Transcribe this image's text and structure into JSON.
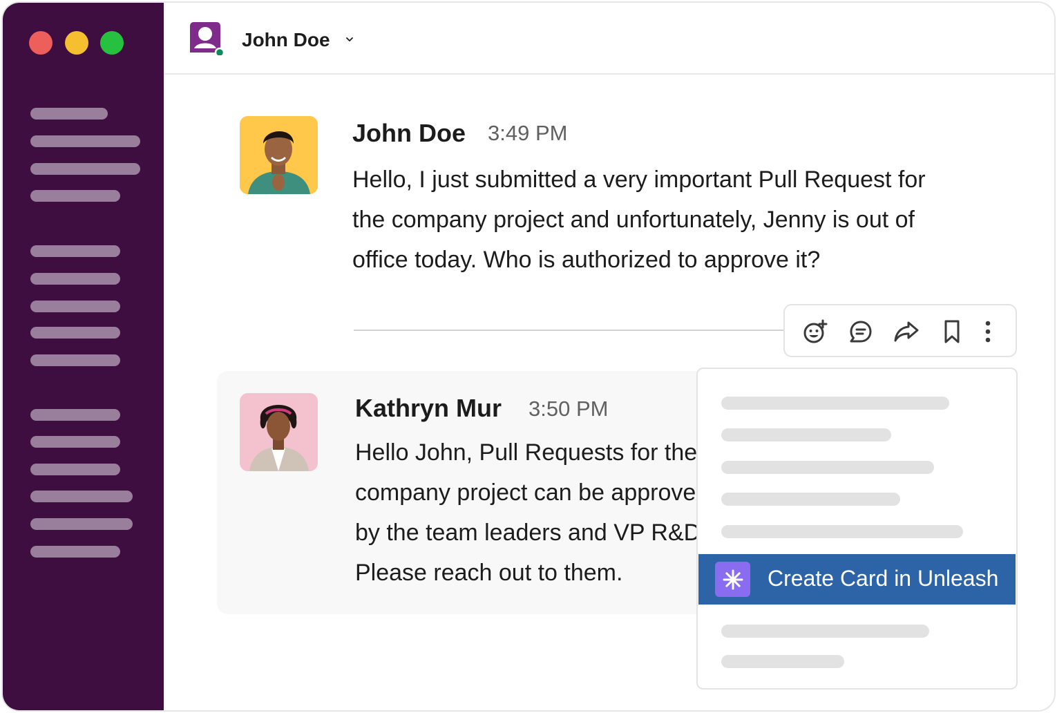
{
  "header": {
    "workspace_name": "John Doe"
  },
  "messages": [
    {
      "author": "John Doe",
      "time": "3:49 PM",
      "lines": [
        "Hello, I just submitted a very important Pull Request for",
        "the company project and unfortunately, Jenny is out of",
        "office today. Who is authorized to approve it?"
      ]
    },
    {
      "author": "Kathryn Mur",
      "time": "3:50 PM",
      "lines": [
        "Hello John, Pull Requests for the",
        "company project can be approved",
        "by the team leaders and VP R&D.",
        "Please reach out to them."
      ]
    }
  ],
  "message_actions": {
    "icons": [
      "add-reaction-icon",
      "reply-in-thread-icon",
      "share-icon",
      "bookmark-icon",
      "more-actions-icon"
    ]
  },
  "context_menu": {
    "highlighted_item": "Create Card in Unleash",
    "highlight_color": "#2d64a8",
    "app_icon_color": "#8a6cf0"
  },
  "colors": {
    "sidebar": "#3f0e40",
    "close": "#ec5f5a",
    "minimize": "#f5bf2f",
    "maximize": "#26c23f",
    "avatar_john_bg": "#ffc84a",
    "avatar_kathryn_bg": "#f4c1cf"
  }
}
